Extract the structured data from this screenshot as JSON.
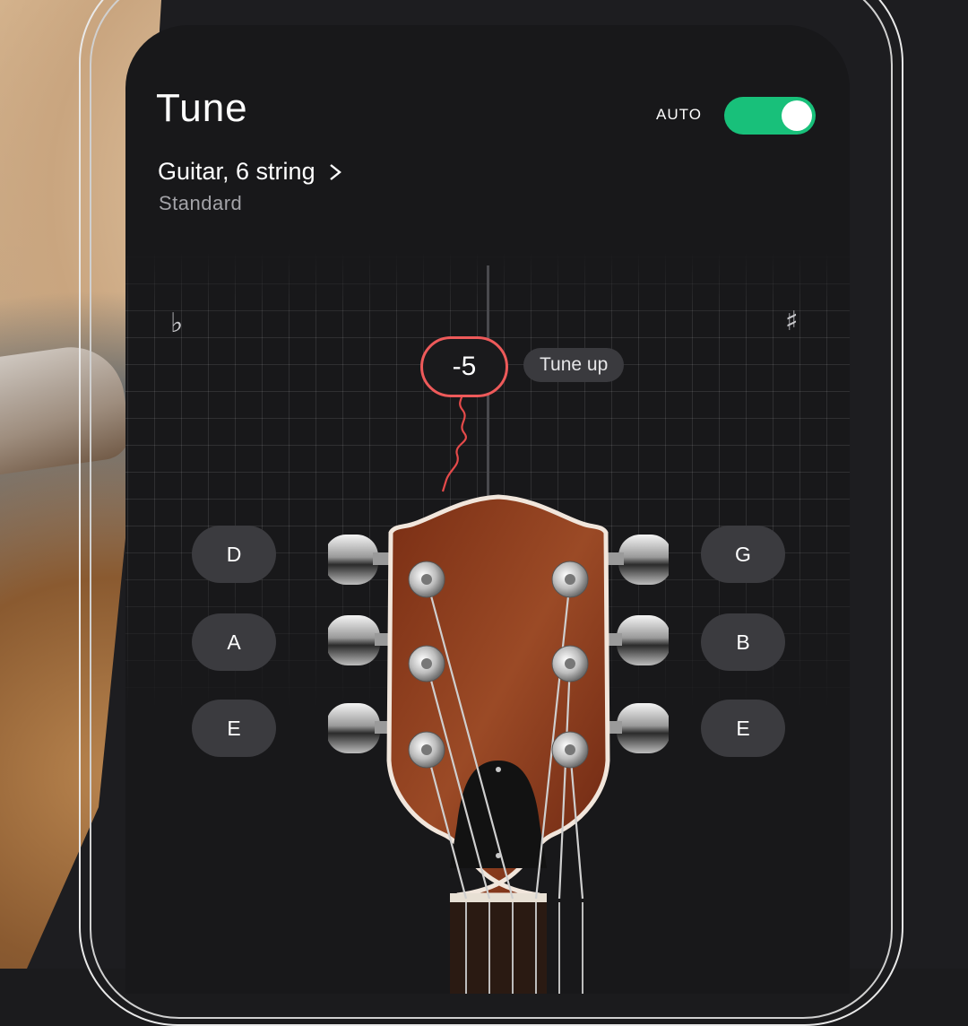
{
  "header": {
    "title": "Tune",
    "auto_label": "AUTO",
    "auto_enabled": true
  },
  "instrument": {
    "name": "Guitar, 6 string",
    "tuning": "Standard"
  },
  "meter": {
    "flat_symbol": "♭",
    "sharp_symbol": "♯",
    "cents_offset": "-5",
    "hint": "Tune up"
  },
  "strings": {
    "left": [
      "D",
      "A",
      "E"
    ],
    "right": [
      "G",
      "B",
      "E"
    ]
  },
  "colors": {
    "accent_green": "#18c07a",
    "indicator_red": "#ee5a5a",
    "screen_bg": "#18181a",
    "note_button_bg": "#3b3b3f"
  }
}
